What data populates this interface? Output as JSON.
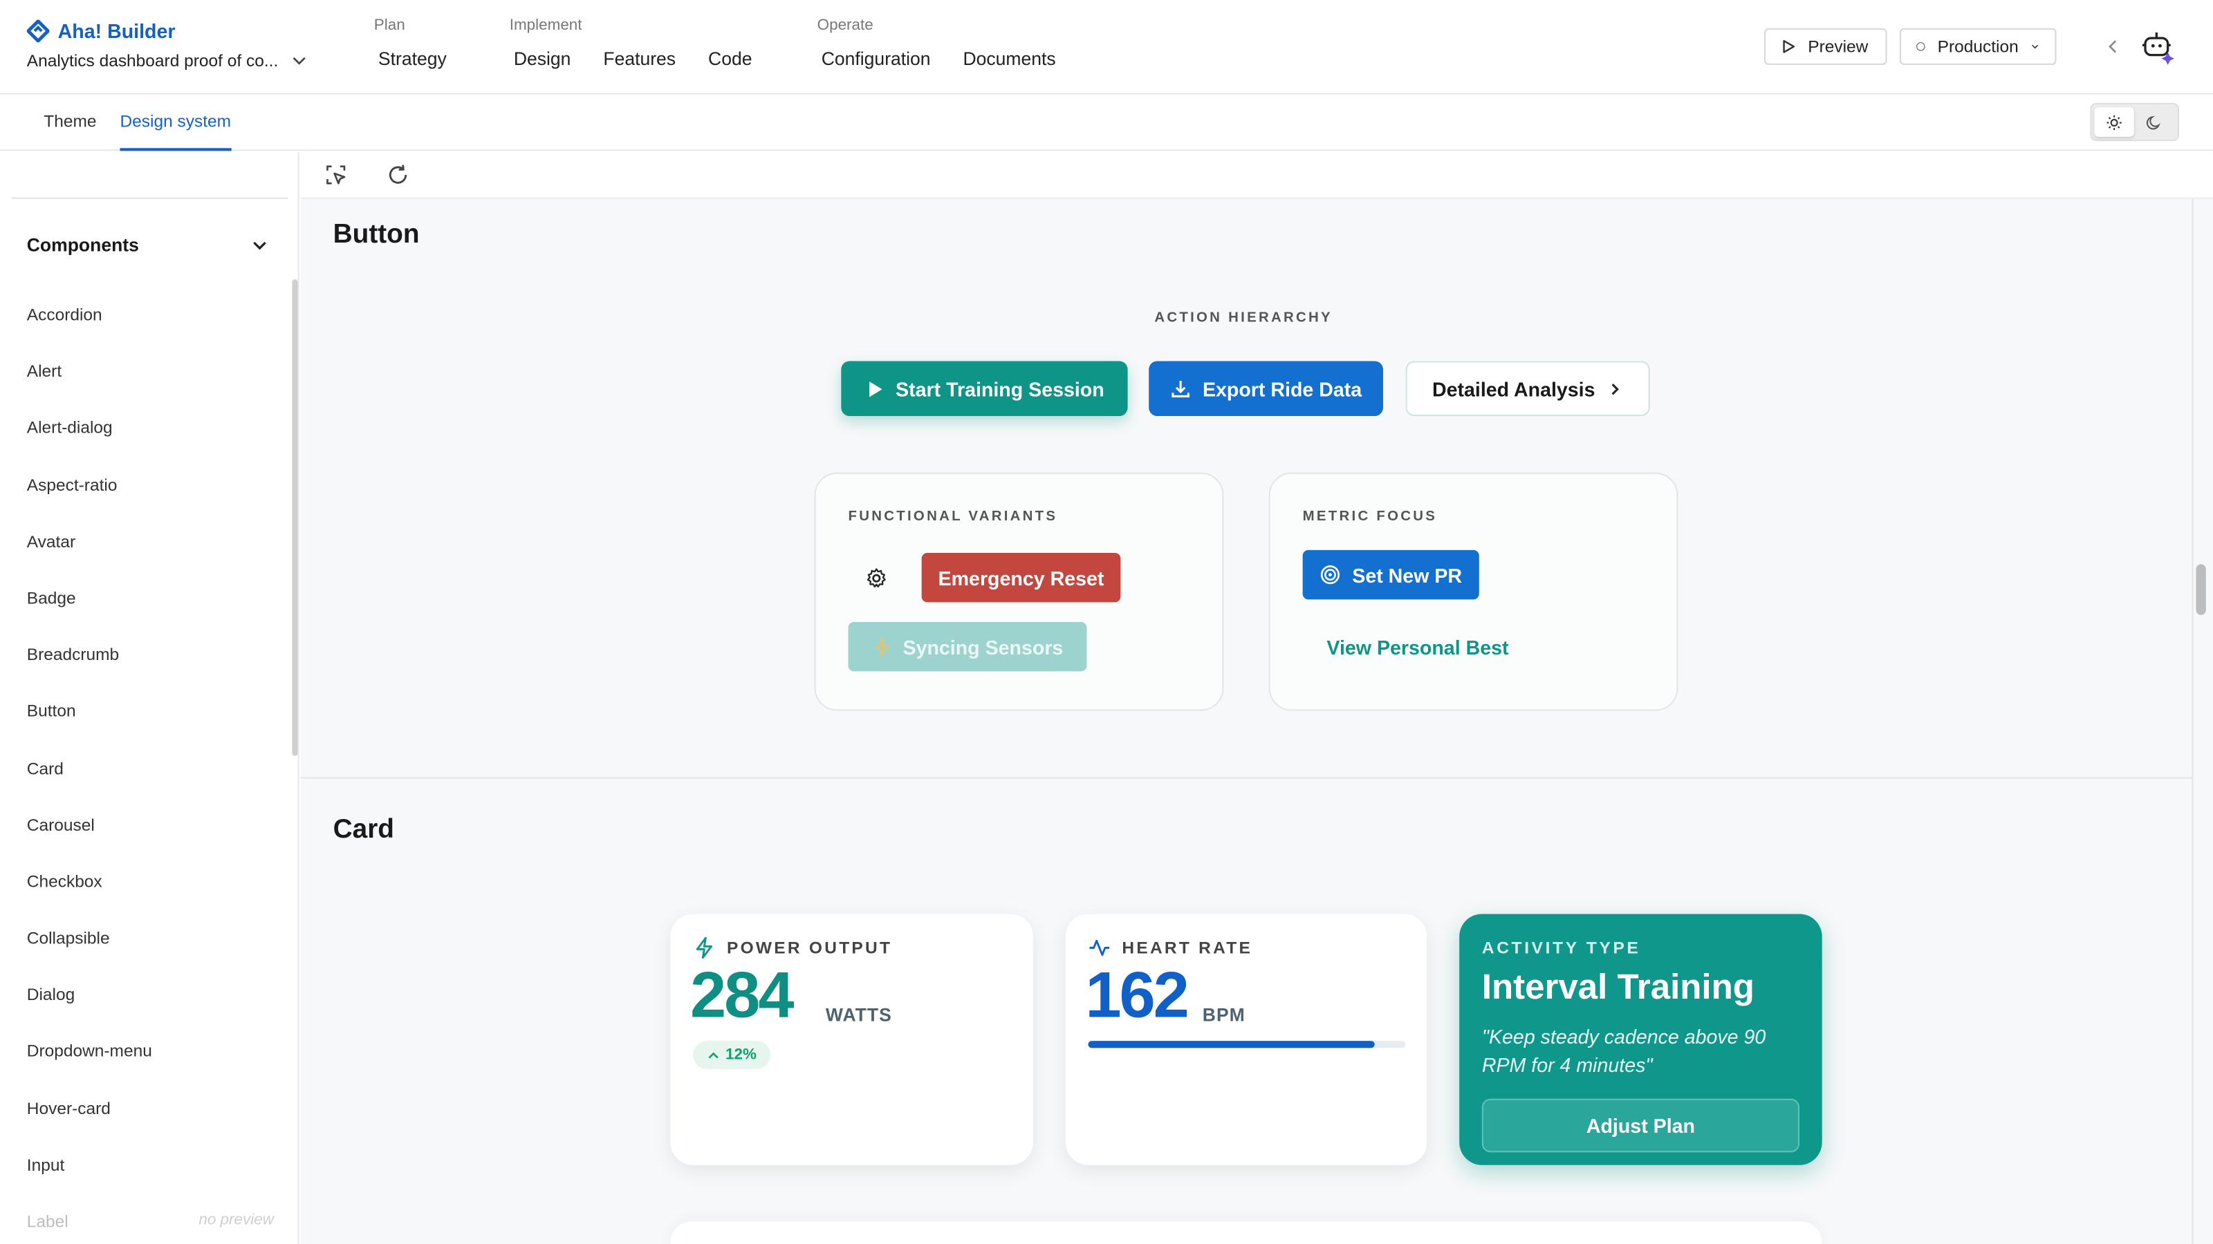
{
  "brand": {
    "name": "Aha! Builder",
    "project": "Analytics dashboard proof of co..."
  },
  "nav": {
    "plan": {
      "label": "Plan",
      "items": [
        "Strategy"
      ]
    },
    "implement": {
      "label": "Implement",
      "items": [
        "Design",
        "Features",
        "Code"
      ]
    },
    "operate": {
      "label": "Operate",
      "items": [
        "Configuration",
        "Documents"
      ]
    }
  },
  "header": {
    "preview_label": "Preview",
    "env_label": "Production"
  },
  "subtabs": [
    "Theme",
    "Design system"
  ],
  "sidebar": {
    "section_title": "Components",
    "items": [
      "Accordion",
      "Alert",
      "Alert-dialog",
      "Aspect-ratio",
      "Avatar",
      "Badge",
      "Breadcrumb",
      "Button",
      "Card",
      "Carousel",
      "Checkbox",
      "Collapsible",
      "Dialog",
      "Dropdown-menu",
      "Hover-card",
      "Input",
      "Label"
    ],
    "no_preview_label": "no preview"
  },
  "button_section": {
    "title": "Button",
    "hierarchy_label": "ACTION HIERARCHY",
    "primary": "Start Training Session",
    "secondary": "Export Ride Data",
    "tertiary": "Detailed Analysis",
    "functional_label": "FUNCTIONAL VARIANTS",
    "destructive": "Emergency Reset",
    "disabled": "Syncing Sensors",
    "metric_label": "METRIC FOCUS",
    "metric_primary": "Set New PR",
    "metric_link": "View Personal Best"
  },
  "card_section": {
    "title": "Card",
    "power": {
      "label": "POWER OUTPUT",
      "value": "284",
      "unit": "WATTS",
      "delta": "12%"
    },
    "heart": {
      "label": "HEART RATE",
      "value": "162",
      "unit": "BPM",
      "progress": 0.9
    },
    "activity": {
      "label": "ACTIVITY TYPE",
      "title": "Interval Training",
      "quote": "\"Keep steady cadence above 90 RPM for 4 minutes\"",
      "button": "Adjust Plan"
    }
  },
  "colors": {
    "brand": "#1560c2",
    "teal": "#0f9488",
    "blue": "#136fd0",
    "red": "#c4473f"
  }
}
